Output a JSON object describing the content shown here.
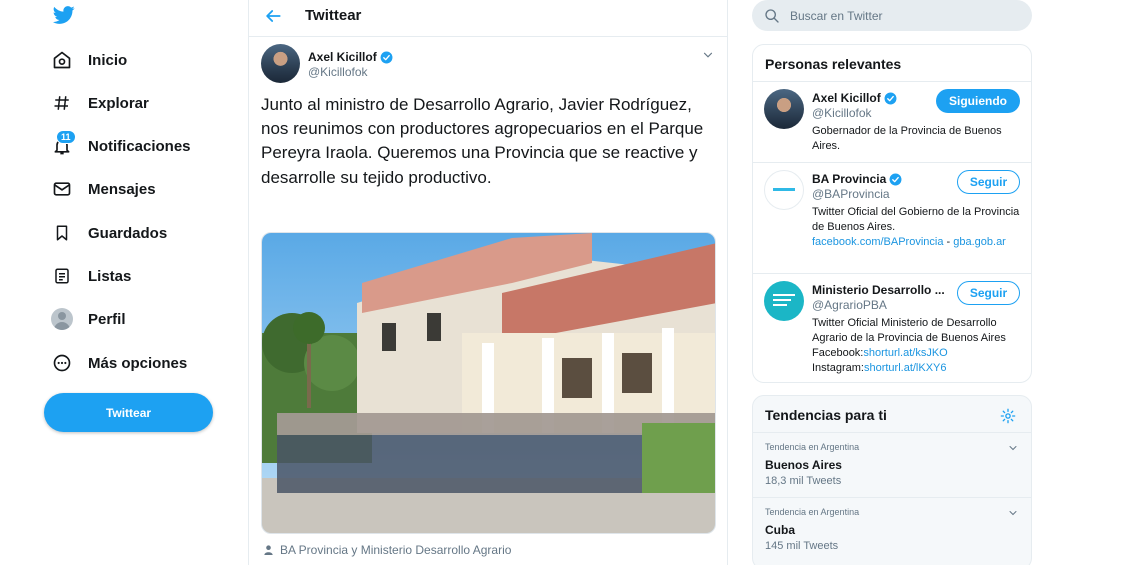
{
  "nav": {
    "logo_icon": "twitter-bird-icon",
    "items": [
      {
        "label": "Inicio",
        "icon": "home-icon"
      },
      {
        "label": "Explorar",
        "icon": "hashtag-icon"
      },
      {
        "label": "Notificaciones",
        "icon": "bell-icon",
        "badge": "11"
      },
      {
        "label": "Mensajes",
        "icon": "envelope-icon"
      },
      {
        "label": "Guardados",
        "icon": "bookmark-icon"
      },
      {
        "label": "Listas",
        "icon": "list-icon"
      },
      {
        "label": "Perfil",
        "icon": "profile-avatar-icon"
      },
      {
        "label": "Más opciones",
        "icon": "more-circle-icon"
      }
    ],
    "tweet_button": "Twittear"
  },
  "header": {
    "title": "Twittear"
  },
  "tweet": {
    "author_name": "Axel Kicillof",
    "author_handle": "@Kicillofok",
    "text": "Junto al ministro de Desarrollo Agrario, Javier Rodríguez, nos reunimos con productores agropecuarios en el Parque Pereyra Iraola. Queremos una Provincia que se reactive y desarrolle su tejido productivo.",
    "tagged": "BA Provincia y Ministerio Desarrollo Agrario"
  },
  "search": {
    "placeholder": "Buscar en Twitter"
  },
  "relevant": {
    "title": "Personas relevantes",
    "people": [
      {
        "name": "Axel Kicillof",
        "handle": "@Kicillofok",
        "button": "Siguiendo",
        "bio": "Gobernador de la Provincia de Buenos Aires."
      },
      {
        "name": "BA Provincia",
        "handle": "@BAProvincia",
        "button": "Seguir",
        "bio": "Twitter Oficial del Gobierno de la Provincia de Buenos Aires.",
        "link1": "facebook.com/BAProvincia",
        "sep": " -",
        "link2": "gba.gob.ar"
      },
      {
        "name": "Ministerio Desarrollo ...",
        "handle": "@AgrarioPBA",
        "button": "Seguir",
        "bio": "Twitter Oficial Ministerio de Desarrollo Agrario de la Provincia de Buenos Aires Facebook:",
        "link1": "shorturl.at/ksJKO",
        "bio2": " Instagram:",
        "link2": "shorturl.at/lKXY6"
      }
    ]
  },
  "trends": {
    "title": "Tendencias para ti",
    "items": [
      {
        "meta": "Tendencia en Argentina",
        "name": "Buenos Aires",
        "count": "18,3 mil Tweets"
      },
      {
        "meta": "Tendencia en Argentina",
        "name": "Cuba",
        "count": "145 mil Tweets"
      }
    ]
  },
  "colors": {
    "accent": "#1da1f2",
    "text": "#14171a",
    "muted": "#657786",
    "border": "#e6ecf0"
  }
}
